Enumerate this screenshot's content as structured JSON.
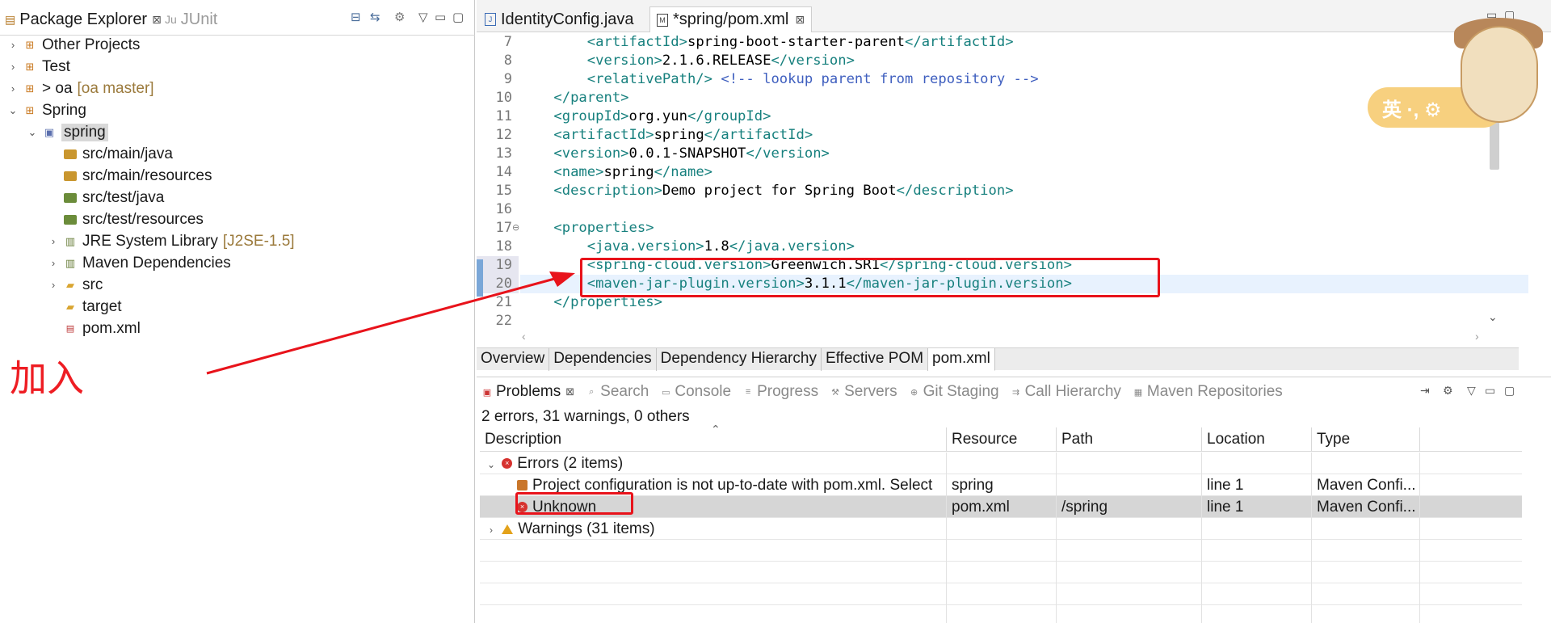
{
  "package_explorer": {
    "tabs": [
      {
        "label": "Package Explorer",
        "close": "⊠"
      },
      {
        "label": "JUnit",
        "prefix": "Ju"
      }
    ],
    "tree": [
      {
        "label": "Other Projects",
        "expanded": false
      },
      {
        "label": "Test",
        "expanded": false
      },
      {
        "label": "> oa",
        "decoration": "[oa master]",
        "expanded": false
      },
      {
        "label": "Spring",
        "expanded": true
      },
      {
        "label": "spring",
        "expanded": true,
        "selected": true
      },
      {
        "label": "src/main/java"
      },
      {
        "label": "src/main/resources"
      },
      {
        "label": "src/test/java"
      },
      {
        "label": "src/test/resources"
      },
      {
        "label": "JRE System Library",
        "decoration": "[J2SE-1.5]",
        "expanded": false
      },
      {
        "label": "Maven Dependencies",
        "expanded": false
      },
      {
        "label": "src",
        "expanded": false
      },
      {
        "label": "target"
      },
      {
        "label": "pom.xml"
      }
    ]
  },
  "annotation": {
    "text": "加入",
    "color": "#ee1d23"
  },
  "editor": {
    "tabs": [
      {
        "label": "IdentityConfig.java",
        "active": false
      },
      {
        "label": "*spring/pom.xml",
        "active": true,
        "close": "⊠"
      }
    ],
    "lines": [
      {
        "n": "7",
        "parts": [
          [
            "tag",
            "        <artifactId>"
          ],
          [
            "txt",
            "spring-boot-starter-parent"
          ],
          [
            "tag",
            "</artifactId>"
          ]
        ]
      },
      {
        "n": "8",
        "parts": [
          [
            "tag",
            "        <version>"
          ],
          [
            "txt",
            "2.1.6.RELEASE"
          ],
          [
            "tag",
            "</version>"
          ]
        ]
      },
      {
        "n": "9",
        "parts": [
          [
            "tag",
            "        <relativePath/> "
          ],
          [
            "cmt",
            "<!-- lookup parent from repository -->"
          ]
        ]
      },
      {
        "n": "10",
        "parts": [
          [
            "tag",
            "    </parent>"
          ]
        ]
      },
      {
        "n": "11",
        "parts": [
          [
            "tag",
            "    <groupId>"
          ],
          [
            "txt",
            "org.yun"
          ],
          [
            "tag",
            "</groupId>"
          ]
        ]
      },
      {
        "n": "12",
        "parts": [
          [
            "tag",
            "    <artifactId>"
          ],
          [
            "txt",
            "spring"
          ],
          [
            "tag",
            "</artifactId>"
          ]
        ]
      },
      {
        "n": "13",
        "parts": [
          [
            "tag",
            "    <version>"
          ],
          [
            "txt",
            "0.0.1-SNAPSHOT"
          ],
          [
            "tag",
            "</version>"
          ]
        ]
      },
      {
        "n": "14",
        "parts": [
          [
            "tag",
            "    <name>"
          ],
          [
            "txt",
            "spring"
          ],
          [
            "tag",
            "</name>"
          ]
        ]
      },
      {
        "n": "15",
        "parts": [
          [
            "tag",
            "    <description>"
          ],
          [
            "txt",
            "Demo project for Spring Boot"
          ],
          [
            "tag",
            "</description>"
          ]
        ]
      },
      {
        "n": "16",
        "parts": []
      },
      {
        "n": "17",
        "fold": "⊖",
        "parts": [
          [
            "tag",
            "    <properties>"
          ]
        ]
      },
      {
        "n": "18",
        "parts": [
          [
            "tag",
            "        <java.version>"
          ],
          [
            "txt",
            "1.8"
          ],
          [
            "tag",
            "</java.version>"
          ]
        ]
      },
      {
        "n": "19",
        "hl": true,
        "parts": [
          [
            "tag",
            "        <spring-cloud.version>"
          ],
          [
            "txt",
            "Greenwich.SR1"
          ],
          [
            "tag",
            "</spring-cloud.version>"
          ]
        ]
      },
      {
        "n": "20",
        "current": true,
        "parts": [
          [
            "tag",
            "        <maven-jar-plugin.version>"
          ],
          [
            "txt",
            "3.1.1"
          ],
          [
            "tag",
            "</maven-jar-plugin.version>"
          ]
        ]
      },
      {
        "n": "21",
        "parts": [
          [
            "tag",
            "    </properties>"
          ]
        ]
      },
      {
        "n": "22",
        "parts": []
      }
    ],
    "bottom_tabs": [
      {
        "label": "Overview",
        "active": false
      },
      {
        "label": "Dependencies",
        "active": false
      },
      {
        "label": "Dependency Hierarchy",
        "active": false
      },
      {
        "label": "Effective POM",
        "active": false
      },
      {
        "label": "pom.xml",
        "active": true
      }
    ],
    "ime_label": "英 ·, ⚙"
  },
  "problems": {
    "tabs": [
      {
        "label": "Problems",
        "active": true,
        "close": "⊠"
      },
      {
        "label": "Search"
      },
      {
        "label": "Console"
      },
      {
        "label": "Progress"
      },
      {
        "label": "Servers"
      },
      {
        "label": "Git Staging"
      },
      {
        "label": "Call Hierarchy"
      },
      {
        "label": "Maven Repositories"
      }
    ],
    "summary": "2 errors, 31 warnings, 0 others",
    "columns": [
      "Description",
      "Resource",
      "Path",
      "Location",
      "Type"
    ],
    "rows": [
      {
        "kind": "group-error",
        "expanded": true,
        "description": "Errors (2 items)",
        "resource": "",
        "path": "",
        "location": "",
        "type": ""
      },
      {
        "kind": "item-config",
        "description": "Project configuration is not up-to-date with pom.xml. Select",
        "resource": "spring",
        "path": "",
        "location": "line 1",
        "type": "Maven Confi..."
      },
      {
        "kind": "item-error",
        "selected": true,
        "description": "Unknown",
        "resource": "pom.xml",
        "path": "/spring",
        "location": "line 1",
        "type": "Maven Confi..."
      },
      {
        "kind": "group-warning",
        "expanded": false,
        "description": "Warnings (31 items)",
        "resource": "",
        "path": "",
        "location": "",
        "type": ""
      }
    ],
    "empty_rows": 4
  },
  "colors": {
    "annotation_red": "#e8131b",
    "xml_tag": "#17807e",
    "xml_comment": "#3f5fbf"
  }
}
